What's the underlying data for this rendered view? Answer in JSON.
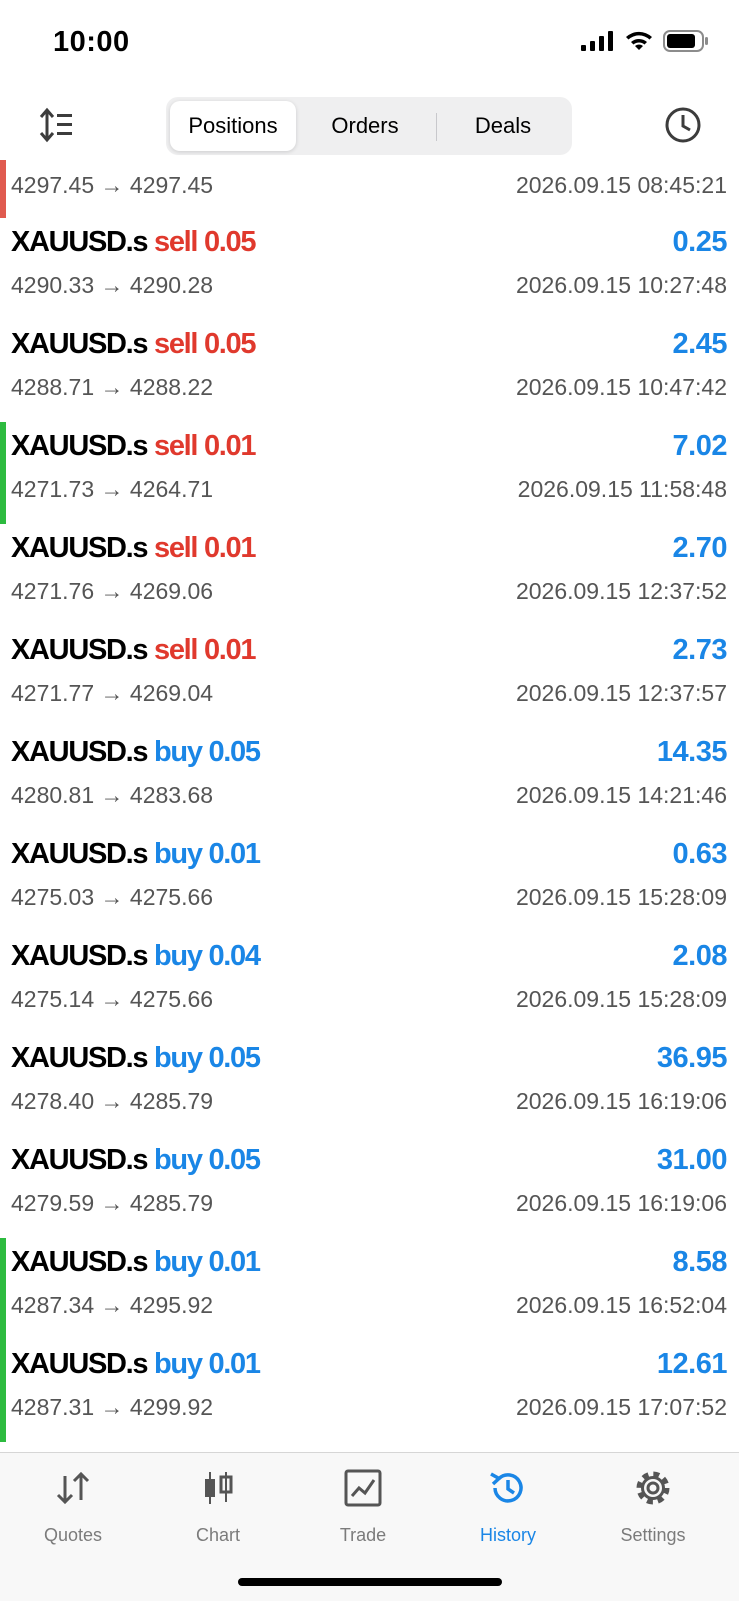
{
  "status_bar": {
    "time": "10:00",
    "icons": [
      "cellular-signal-icon",
      "wifi-icon",
      "battery-icon"
    ]
  },
  "toolbar": {
    "sort_icon": "sort-icon",
    "history_icon": "clock-icon",
    "segments": [
      {
        "label": "Positions",
        "selected": true
      },
      {
        "label": "Orders",
        "selected": false
      },
      {
        "label": "Deals",
        "selected": false
      }
    ]
  },
  "colors": {
    "sell": "#e0392d",
    "buy": "#1a86e6",
    "loss_marker": "#e05a4f",
    "profit_marker": "#2dbb3f"
  },
  "deals": [
    {
      "symbol": "",
      "side": "",
      "volume": "",
      "profit": "",
      "prices": "4297.45 → 4297.45",
      "time": "2026.09.15 08:45:21",
      "marker": "red"
    },
    {
      "symbol": "XAUUSD.s",
      "side": "sell",
      "volume": "0.05",
      "profit": "0.25",
      "prices": "4290.33 → 4290.28",
      "time": "2026.09.15 10:27:48",
      "marker": ""
    },
    {
      "symbol": "XAUUSD.s",
      "side": "sell",
      "volume": "0.05",
      "profit": "2.45",
      "prices": "4288.71 → 4288.22",
      "time": "2026.09.15 10:47:42",
      "marker": ""
    },
    {
      "symbol": "XAUUSD.s",
      "side": "sell",
      "volume": "0.01",
      "profit": "7.02",
      "prices": "4271.73 → 4264.71",
      "time": "2026.09.15 11:58:48",
      "marker": "green"
    },
    {
      "symbol": "XAUUSD.s",
      "side": "sell",
      "volume": "0.01",
      "profit": "2.70",
      "prices": "4271.76 → 4269.06",
      "time": "2026.09.15 12:37:52",
      "marker": ""
    },
    {
      "symbol": "XAUUSD.s",
      "side": "sell",
      "volume": "0.01",
      "profit": "2.73",
      "prices": "4271.77 → 4269.04",
      "time": "2026.09.15 12:37:57",
      "marker": ""
    },
    {
      "symbol": "XAUUSD.s",
      "side": "buy",
      "volume": "0.05",
      "profit": "14.35",
      "prices": "4280.81 → 4283.68",
      "time": "2026.09.15 14:21:46",
      "marker": ""
    },
    {
      "symbol": "XAUUSD.s",
      "side": "buy",
      "volume": "0.01",
      "profit": "0.63",
      "prices": "4275.03 → 4275.66",
      "time": "2026.09.15 15:28:09",
      "marker": ""
    },
    {
      "symbol": "XAUUSD.s",
      "side": "buy",
      "volume": "0.04",
      "profit": "2.08",
      "prices": "4275.14 → 4275.66",
      "time": "2026.09.15 15:28:09",
      "marker": ""
    },
    {
      "symbol": "XAUUSD.s",
      "side": "buy",
      "volume": "0.05",
      "profit": "36.95",
      "prices": "4278.40 → 4285.79",
      "time": "2026.09.15 16:19:06",
      "marker": ""
    },
    {
      "symbol": "XAUUSD.s",
      "side": "buy",
      "volume": "0.05",
      "profit": "31.00",
      "prices": "4279.59 → 4285.79",
      "time": "2026.09.15 16:19:06",
      "marker": ""
    },
    {
      "symbol": "XAUUSD.s",
      "side": "buy",
      "volume": "0.01",
      "profit": "8.58",
      "prices": "4287.34 → 4295.92",
      "time": "2026.09.15 16:52:04",
      "marker": "green"
    },
    {
      "symbol": "XAUUSD.s",
      "side": "buy",
      "volume": "0.01",
      "profit": "12.61",
      "prices": "4287.31 → 4299.92",
      "time": "2026.09.15 17:07:52",
      "marker": "green"
    }
  ],
  "tabbar": {
    "items": [
      {
        "label": "Quotes",
        "icon": "quotes-arrows-icon",
        "active": false
      },
      {
        "label": "Chart",
        "icon": "candlestick-chart-icon",
        "active": false
      },
      {
        "label": "Trade",
        "icon": "trade-chart-icon",
        "active": false
      },
      {
        "label": "History",
        "icon": "history-clock-icon",
        "active": true
      },
      {
        "label": "Settings",
        "icon": "gear-icon",
        "active": false
      }
    ]
  }
}
